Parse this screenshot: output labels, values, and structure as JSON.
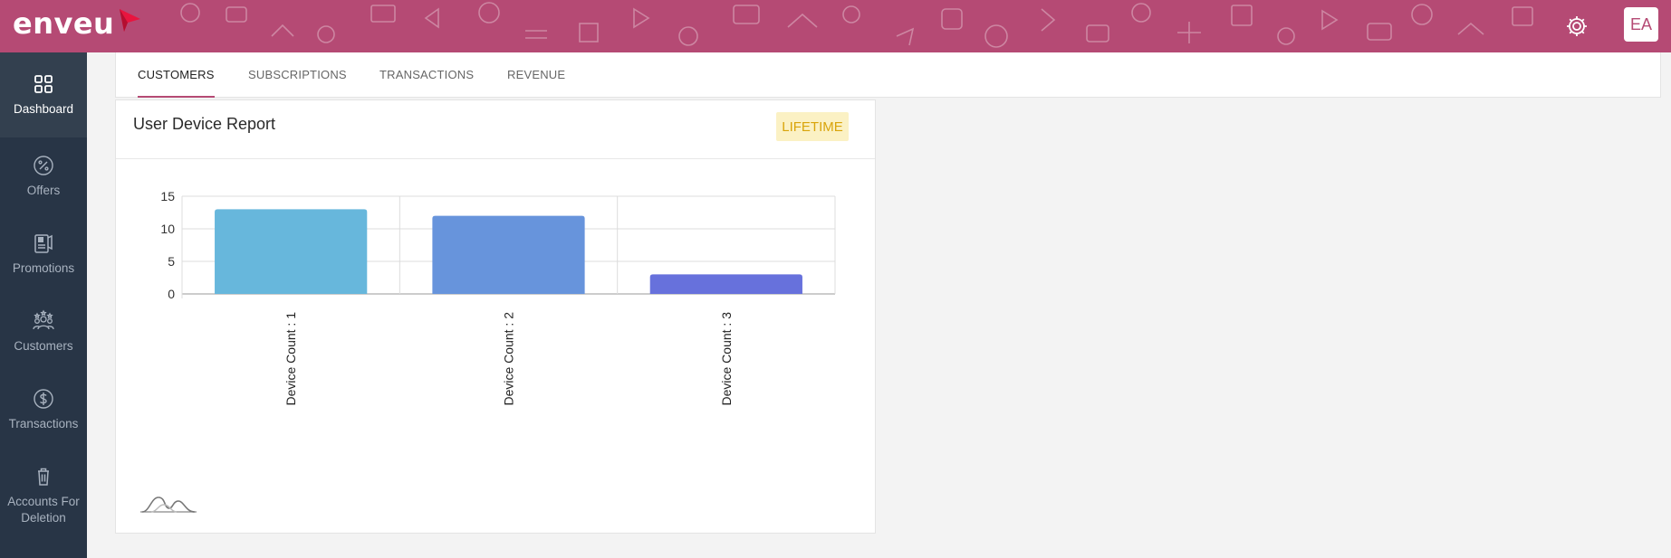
{
  "header": {
    "logo_text": "enveu",
    "avatar_initials": "EA",
    "background_color": "#b54a74"
  },
  "sidebar": {
    "items": [
      {
        "label": "Dashboard",
        "icon": "grid-icon",
        "active": true
      },
      {
        "label": "Offers",
        "icon": "percent-icon",
        "active": false
      },
      {
        "label": "Promotions",
        "icon": "promo-icon",
        "active": false
      },
      {
        "label": "Customers",
        "icon": "customers-icon",
        "active": false
      },
      {
        "label": "Transactions",
        "icon": "dollar-icon",
        "active": false
      },
      {
        "label": "Accounts For Deletion",
        "icon": "trash-icon",
        "active": false
      }
    ]
  },
  "tabs": [
    {
      "label": "CUSTOMERS",
      "active": true
    },
    {
      "label": "SUBSCRIPTIONS",
      "active": false
    },
    {
      "label": "TRANSACTIONS",
      "active": false
    },
    {
      "label": "REVENUE",
      "active": false
    }
  ],
  "card": {
    "title": "User Device Report",
    "badge": "LIFETIME"
  },
  "chart_data": {
    "type": "bar",
    "categories": [
      "Device Count : 1",
      "Device Count : 2",
      "Device Count : 3"
    ],
    "values": [
      13,
      12,
      3
    ],
    "colors": [
      "#67b7dc",
      "#6794dc",
      "#6771dc"
    ],
    "ylim": [
      0,
      15
    ],
    "yticks": [
      0,
      5,
      10,
      15
    ],
    "grid": true,
    "title": "",
    "xlabel": "",
    "ylabel": ""
  }
}
